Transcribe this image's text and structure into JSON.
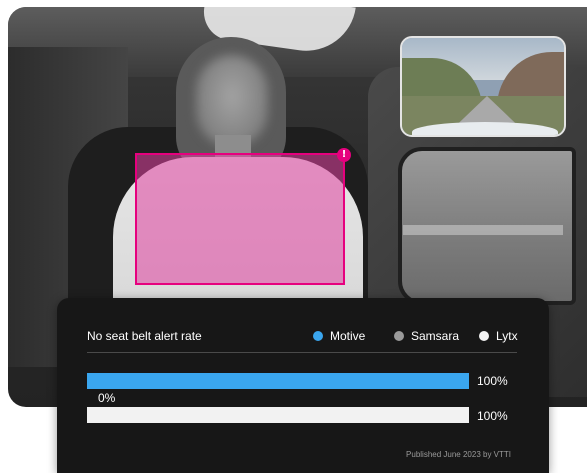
{
  "camera": {
    "alert_glyph": "!",
    "accent_color": "#e6007e"
  },
  "stats": {
    "title": "No seat belt alert rate",
    "legend": [
      {
        "name": "Motive",
        "color": "#3aa6ef"
      },
      {
        "name": "Samsara",
        "color": "#9a9a9a"
      },
      {
        "name": "Lytx",
        "color": "#f2f2f2"
      }
    ],
    "bars": [
      {
        "name": "Motive",
        "value_label": "100%",
        "fraction": 1.0,
        "color": "#3aa6ef"
      },
      {
        "name": "Samsara",
        "value_label": "0%",
        "fraction": 0.0,
        "color": "#9a9a9a"
      },
      {
        "name": "Lytx",
        "value_label": "100%",
        "fraction": 1.0,
        "color": "#f2f2f2"
      }
    ],
    "footer": "Published June 2023 by VTTI"
  }
}
